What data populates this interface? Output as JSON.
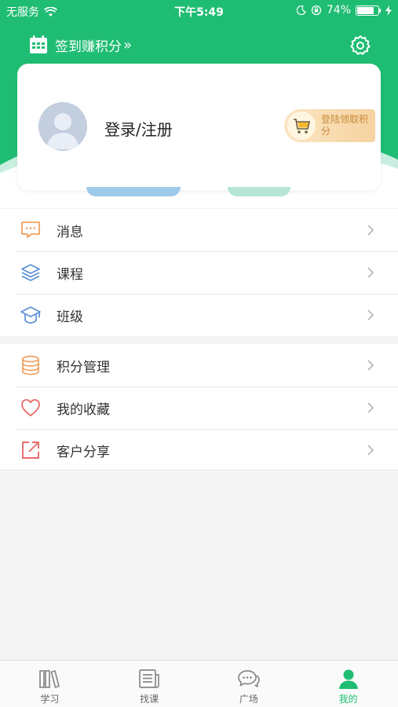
{
  "status_bar": {
    "carrier": "无服务",
    "time": "下午5:49",
    "battery": "74%",
    "battery_level": 0.74
  },
  "header": {
    "checkin_label": "签到赚积分",
    "checkin_chevron": "»",
    "settings_icon": "gear-icon"
  },
  "profile": {
    "login_label": "登录/注册",
    "badge_label": "登陆领取积分"
  },
  "menu_group_1": [
    {
      "label": "消息",
      "icon": "message-icon"
    },
    {
      "label": "课程",
      "icon": "layers-icon"
    },
    {
      "label": "班级",
      "icon": "graduation-cap-icon"
    }
  ],
  "menu_group_2": [
    {
      "label": "积分管理",
      "icon": "coin-stack-icon"
    },
    {
      "label": "我的收藏",
      "icon": "heart-icon"
    },
    {
      "label": "客户分享",
      "icon": "share-icon"
    }
  ],
  "tabs": [
    {
      "label": "学习",
      "icon": "books-icon"
    },
    {
      "label": "找课",
      "icon": "news-icon"
    },
    {
      "label": "广场",
      "icon": "chat-icon"
    },
    {
      "label": "我的",
      "icon": "person-icon",
      "active": true
    }
  ],
  "colors": {
    "brand": "#1fbd73",
    "badge_text": "#c98a3a"
  }
}
